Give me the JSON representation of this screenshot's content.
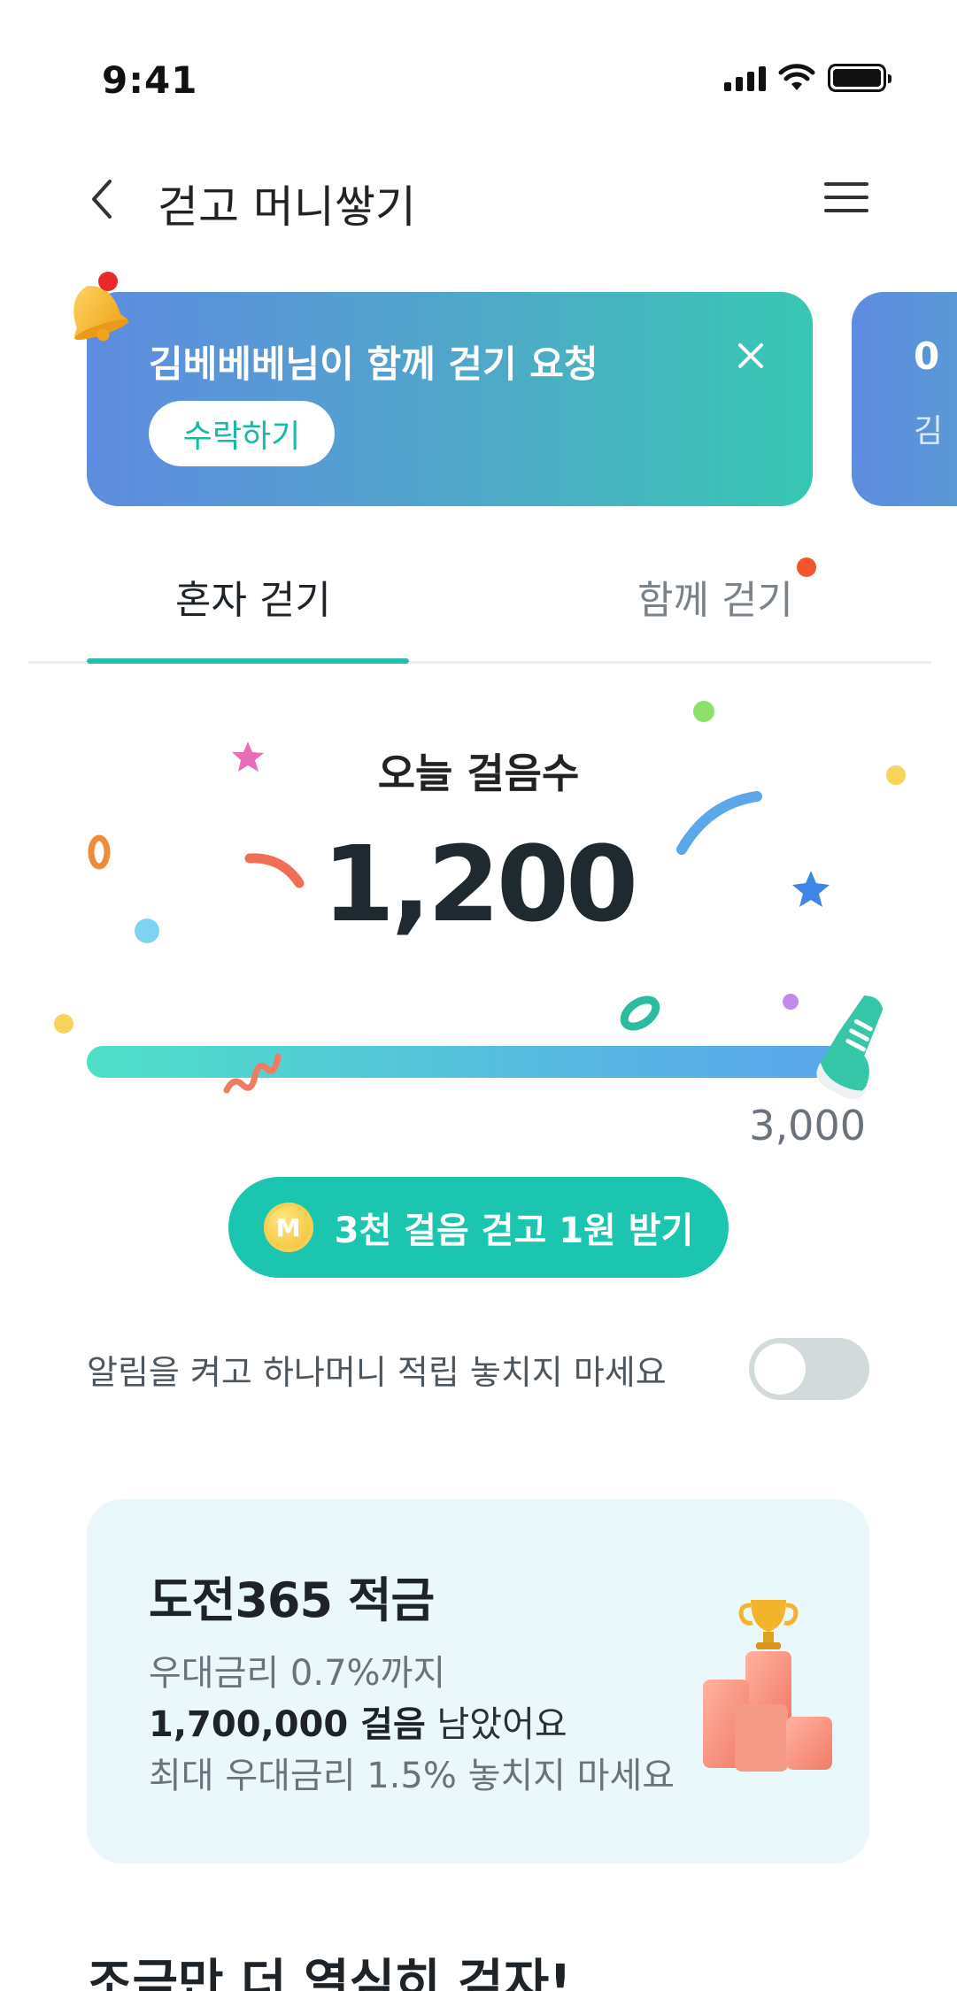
{
  "status_bar": {
    "time": "9:41"
  },
  "header": {
    "title": "걷고 머니쌓기"
  },
  "banner": {
    "title": "김베베베님이 함께 걷기 요청",
    "accept_label": "수락하기",
    "peek_title": "0",
    "peek_subtitle": "김"
  },
  "tabs": [
    {
      "label": "혼자 걷기",
      "active": true
    },
    {
      "label": "함께 걷기",
      "active": false,
      "has_notification_dot": true
    }
  ],
  "steps": {
    "label": "오늘 걸음수",
    "value": "1,200",
    "goal": "3,000",
    "progress_fraction": 1.0
  },
  "reward_button": {
    "coin_letter": "M",
    "label": "3천 걸음 걷고 1원 받기"
  },
  "notification": {
    "text": "알림을 켜고 하나머니 적립 놓치지 마세요",
    "enabled": false
  },
  "challenge_card": {
    "title": "도전365 적금",
    "line1": "우대금리 0.7%까지",
    "line2_bold": "1,700,000 걸음",
    "line2_rest": " 남았어요",
    "line3": "최대 우대금리 1.5% 놓치지 마세요"
  },
  "next_section": {
    "title": "조금만 더 열심히 걷자!"
  },
  "colors": {
    "accent": "#1cc5b0",
    "banner_start": "#5f8be0",
    "banner_end": "#38c7b3",
    "card_bg": "#ebf8fb",
    "notification_dot": "#f2552c"
  }
}
